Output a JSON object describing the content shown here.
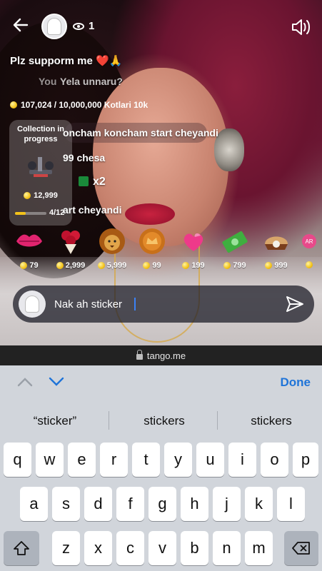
{
  "stream": {
    "viewer_count": "1",
    "chat": {
      "support_line": "Plz supporm me ❤️🙏",
      "line_you": "You",
      "line_yela": "Yela unnaru?",
      "line_start_top": "oncham koncham start cheyandi",
      "line_chesa": "99 chesa",
      "line_x2": "x2",
      "line_start_bottom": "art cheyandi"
    },
    "progress_text": "107,024 / 10,000,000  Kotlari 10k",
    "collection": {
      "title": "Collection in progress",
      "price": "12,999",
      "count": "4/12",
      "progress_fraction": 0.33
    },
    "gifts": [
      {
        "name": "lips-gift",
        "price": "79"
      },
      {
        "name": "rose-bouquet-gift",
        "price": "2,999"
      },
      {
        "name": "lion-gift",
        "price": "5,999"
      },
      {
        "name": "crown-coin-gift",
        "price": "99"
      },
      {
        "name": "hearts-gift",
        "price": "199"
      },
      {
        "name": "money-gift",
        "price": "799"
      },
      {
        "name": "pearl-shell-gift",
        "price": "999"
      },
      {
        "name": "ar-gift",
        "price": ""
      }
    ],
    "comment_input": {
      "value": "Nak ah sticker"
    }
  },
  "browser": {
    "url": "tango.me"
  },
  "keyboard": {
    "done_label": "Done",
    "suggestions": [
      "“sticker”",
      "stickers",
      "stickers"
    ],
    "row1": [
      "q",
      "w",
      "e",
      "r",
      "t",
      "y",
      "u",
      "i",
      "o",
      "p"
    ],
    "row2": [
      "a",
      "s",
      "d",
      "f",
      "g",
      "h",
      "j",
      "k",
      "l"
    ],
    "row3": [
      "z",
      "x",
      "c",
      "v",
      "b",
      "n",
      "m"
    ]
  },
  "colors": {
    "accent_blue": "#1f74d8",
    "coin_gold": "#f2c21a"
  }
}
